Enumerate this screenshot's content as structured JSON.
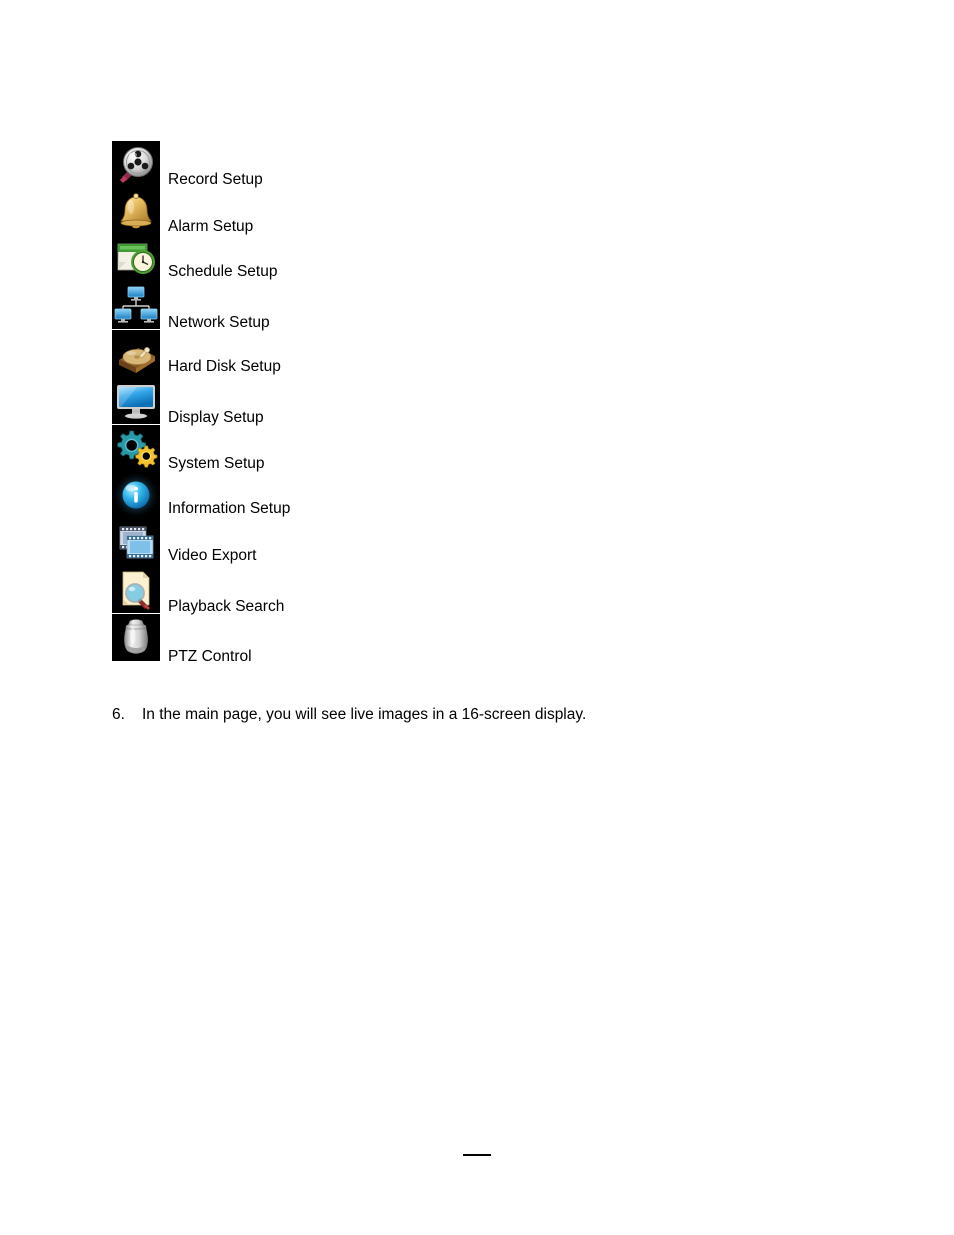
{
  "document": {
    "menu_items": [
      {
        "label": "Record Setup",
        "icon": "film-reel-icon"
      },
      {
        "label": "Alarm Setup",
        "icon": "bell-icon"
      },
      {
        "label": "Schedule Setup",
        "icon": "calendar-clock-icon"
      },
      {
        "label": "Network Setup",
        "icon": "network-monitors-icon"
      },
      {
        "label": "Hard Disk Setup",
        "icon": "hard-disk-icon"
      },
      {
        "label": "Display Setup",
        "icon": "monitor-icon"
      },
      {
        "label": "System Setup",
        "icon": "gears-icon"
      },
      {
        "label": "Information Setup",
        "icon": "info-sphere-icon"
      },
      {
        "label": "Video Export",
        "icon": "film-frames-icon"
      },
      {
        "label": "Playback Search",
        "icon": "document-magnifier-icon"
      },
      {
        "label": "PTZ Control",
        "icon": "dome-camera-icon"
      }
    ],
    "step": {
      "number": "6.",
      "text": "In the main page, you will see live images in a 16-screen display."
    },
    "colors": {
      "page_background": "#ffffff",
      "text": "#000000",
      "icon_tile_background": "#000000",
      "accent_blue": "#3ba7e8",
      "accent_green": "#3f9c35",
      "accent_gold": "#e0b54a",
      "accent_teal": "#2a9aa8",
      "accent_yellow": "#f2c230",
      "accent_silver": "#d8d8d8"
    }
  }
}
